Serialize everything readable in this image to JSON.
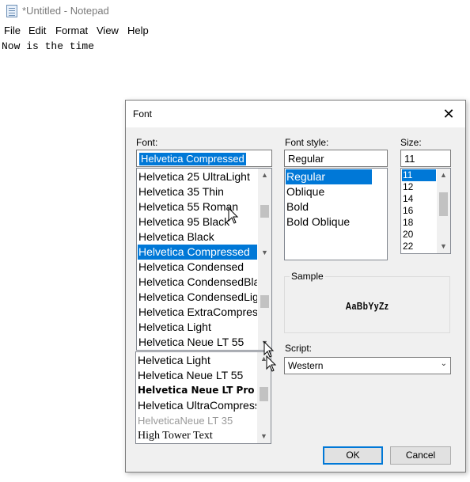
{
  "window": {
    "title": "*Untitled - Notepad"
  },
  "menu": [
    "File",
    "Edit",
    "Format",
    "View",
    "Help"
  ],
  "editor": {
    "text": "Now is the time"
  },
  "dialog": {
    "title": "Font",
    "close": "✕",
    "font_label": "Font:",
    "font_value": "Helvetica Compressed",
    "font_items": [
      "Helvetica 25 UltraLight",
      "Helvetica 35 Thin",
      "Helvetica 55 Roman",
      "Helvetica 95 Black",
      "Helvetica Black",
      "Helvetica Compressed",
      "Helvetica Condensed",
      "Helvetica CondensedBlack",
      "Helvetica CondensedLight",
      "Helvetica ExtraCompressed",
      "Helvetica Light",
      "Helvetica Neue LT 55"
    ],
    "font_items_lower": [
      "Helvetica Light",
      "Helvetica Neue LT 55",
      "Helvetica Neue LT Pro",
      "Helvetica UltraCompressed",
      "HelveticaNeue LT 35",
      "High Tower Text"
    ],
    "style_label": "Font style:",
    "style_value": "Regular",
    "style_items": [
      "Regular",
      "Oblique",
      "Bold",
      "Bold Oblique"
    ],
    "size_label": "Size:",
    "size_value": "11",
    "size_items": [
      "11",
      "12",
      "14",
      "16",
      "18",
      "20",
      "22"
    ],
    "sample_label": "Sample",
    "sample_text": "AaBbYyZz",
    "script_label": "Script:",
    "script_value": "Western",
    "ok": "OK",
    "cancel": "Cancel"
  },
  "colors": {
    "selection": "#0078d7",
    "dialog_bg": "#f0f0f0"
  }
}
